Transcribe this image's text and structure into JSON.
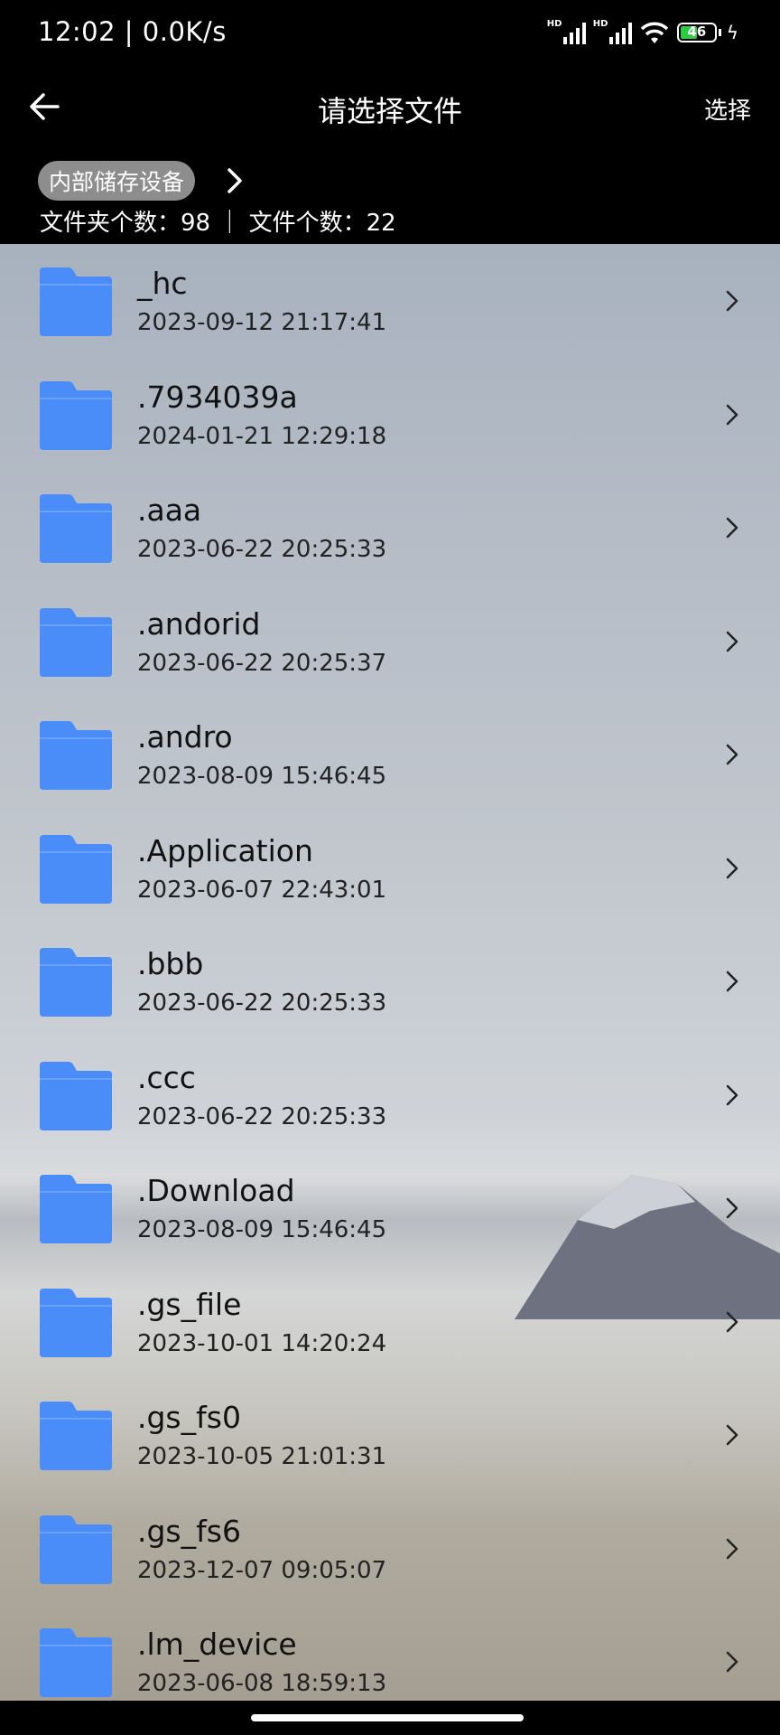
{
  "status_bar": {
    "time": "12:02 | 0.0K/s",
    "hd_label_1": "HD",
    "hd_label_2": "HD",
    "battery": "46"
  },
  "header": {
    "back_icon": "arrow-left-icon",
    "title": "请选择文件",
    "select_label": "选择",
    "breadcrumb_chip": "内部储存设备",
    "counts": "文件夹个数：98 ｜ 文件个数：22"
  },
  "folders": [
    {
      "name": "_hc",
      "date": "2023-09-12 21:17:41"
    },
    {
      "name": ".7934039a",
      "date": "2024-01-21 12:29:18"
    },
    {
      "name": ".aaa",
      "date": "2023-06-22 20:25:33"
    },
    {
      "name": ".andorid",
      "date": "2023-06-22 20:25:37"
    },
    {
      "name": ".andro",
      "date": "2023-08-09 15:46:45"
    },
    {
      "name": ".Application",
      "date": "2023-06-07 22:43:01"
    },
    {
      "name": ".bbb",
      "date": "2023-06-22 20:25:33"
    },
    {
      "name": ".ccc",
      "date": "2023-06-22 20:25:33"
    },
    {
      "name": ".Download",
      "date": "2023-08-09 15:46:45"
    },
    {
      "name": ".gs_file",
      "date": "2023-10-01 14:20:24"
    },
    {
      "name": ".gs_fs0",
      "date": "2023-10-05 21:01:31"
    },
    {
      "name": ".gs_fs6",
      "date": "2023-12-07 09:05:07"
    },
    {
      "name": ".lm_device",
      "date": "2023-06-08 18:59:13"
    }
  ],
  "colors": {
    "folder": "#4a8df8",
    "folder_tab": "#5a98fa",
    "battery_fill": "#2ecc40"
  }
}
